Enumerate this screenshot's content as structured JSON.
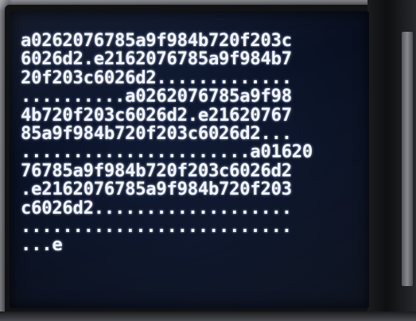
{
  "display": {
    "lines": [
      "a0262076785a9f984b720f203c",
      "6026d2.e2162076785a9f984b7",
      "20f203c6026d2.............",
      "..........a0262076785a9f98",
      "4b720f203c6026d2.e21620767",
      "85a9f984b720f203c6026d2...",
      "......................a01620",
      "76785a9f984b720f203c6026d2",
      ".e2162076785a9f984b720f203",
      "c6026d2...................",
      "..........................",
      "...e"
    ]
  }
}
